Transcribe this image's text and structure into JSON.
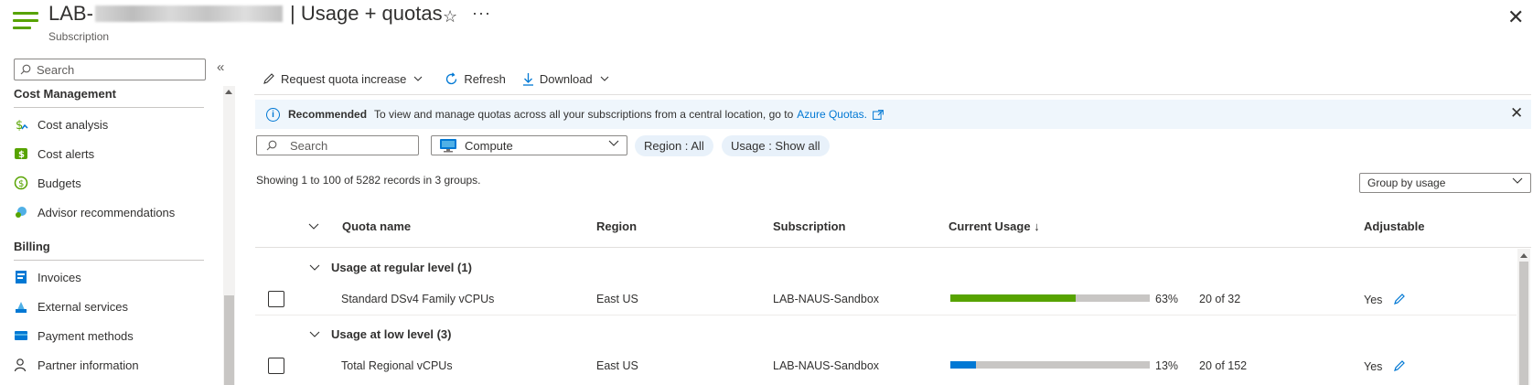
{
  "header": {
    "title_prefix": "LAB-",
    "title_suffix": "| Usage + quotas",
    "subtitle": "Subscription"
  },
  "nav": {
    "search_placeholder": "Search",
    "sections": [
      {
        "title": "Cost Management",
        "items": [
          {
            "label": "Cost analysis",
            "icon": "cost-analysis-icon"
          },
          {
            "label": "Cost alerts",
            "icon": "cost-alerts-icon"
          },
          {
            "label": "Budgets",
            "icon": "budgets-icon"
          },
          {
            "label": "Advisor recommendations",
            "icon": "advisor-icon"
          }
        ]
      },
      {
        "title": "Billing",
        "items": [
          {
            "label": "Invoices",
            "icon": "invoices-icon"
          },
          {
            "label": "External services",
            "icon": "external-services-icon"
          },
          {
            "label": "Payment methods",
            "icon": "payment-methods-icon"
          },
          {
            "label": "Partner information",
            "icon": "partner-icon"
          }
        ]
      }
    ]
  },
  "toolbar": {
    "request_label": "Request quota increase",
    "refresh_label": "Refresh",
    "download_label": "Download"
  },
  "banner": {
    "title": "Recommended",
    "text": "To view and manage quotas across all your subscriptions from a central location, go to",
    "link": "Azure Quotas."
  },
  "filters": {
    "search_placeholder": "Search",
    "provider": "Compute",
    "region_pill": "Region : All",
    "usage_pill": "Usage : Show all"
  },
  "summary": "Showing 1 to 100 of 5282 records in 3 groups.",
  "group_by": "Group by usage",
  "columns": {
    "quota_name": "Quota name",
    "region": "Region",
    "subscription": "Subscription",
    "current_usage": "Current Usage ↓",
    "adjustable": "Adjustable"
  },
  "groups": [
    {
      "title": "Usage at regular level (1)",
      "rows": [
        {
          "name": "Standard DSv4 Family vCPUs",
          "region": "East US",
          "subscription": "LAB-NAUS-Sandbox",
          "percent_label": "63%",
          "percent": 63,
          "count": "20 of 32",
          "adjustable": "Yes",
          "bar_color": "#57a300"
        }
      ]
    },
    {
      "title": "Usage at low level (3)",
      "rows": [
        {
          "name": "Total Regional vCPUs",
          "region": "East US",
          "subscription": "LAB-NAUS-Sandbox",
          "percent_label": "13%",
          "percent": 13,
          "count": "20 of 152",
          "adjustable": "Yes",
          "bar_color": "#0078d4"
        }
      ]
    }
  ]
}
